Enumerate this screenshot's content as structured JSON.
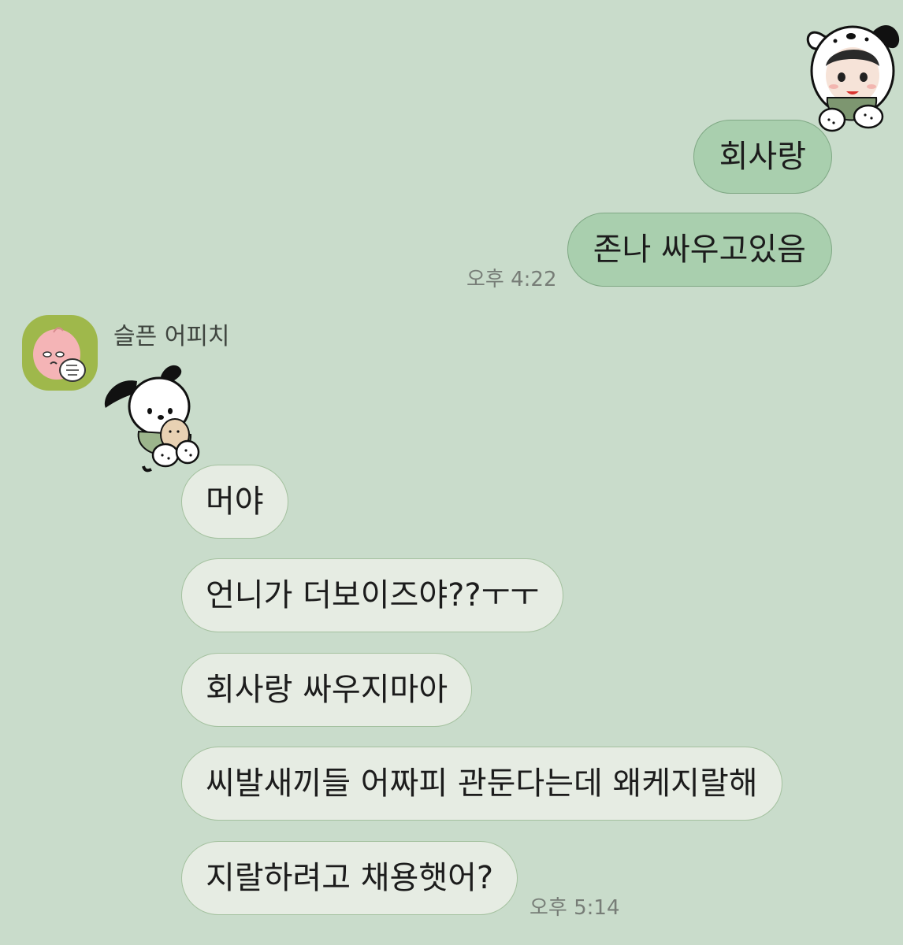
{
  "chat": {
    "sender_name": "슬픈 어피치",
    "outgoing": [
      {
        "text": "회사랑"
      },
      {
        "text": "존나 싸우고있음"
      }
    ],
    "outgoing_time": "오후 4:22",
    "incoming": [
      {
        "text": "머야"
      },
      {
        "text": "언니가 더보이즈야??ㅜㅜ"
      },
      {
        "text": "회사랑 싸우지마아"
      },
      {
        "text": "씨발새끼들 어짜피 관둔다는데 왜케지랄해"
      },
      {
        "text": "지랄하려고 채용햇어?"
      }
    ],
    "incoming_time": "오후 5:14"
  },
  "colors": {
    "background": "#c9dccb",
    "outgoing_bubble": "#a9cfae",
    "incoming_bubble": "#e6ece3",
    "avatar_bg": "#9fb84b"
  },
  "icons": {
    "sender_avatar": "crying-peach-avatar-icon",
    "outgoing_sticker": "boy-in-dog-hood-sticker",
    "incoming_sticker": "white-puppy-hugging-bear-sticker"
  }
}
